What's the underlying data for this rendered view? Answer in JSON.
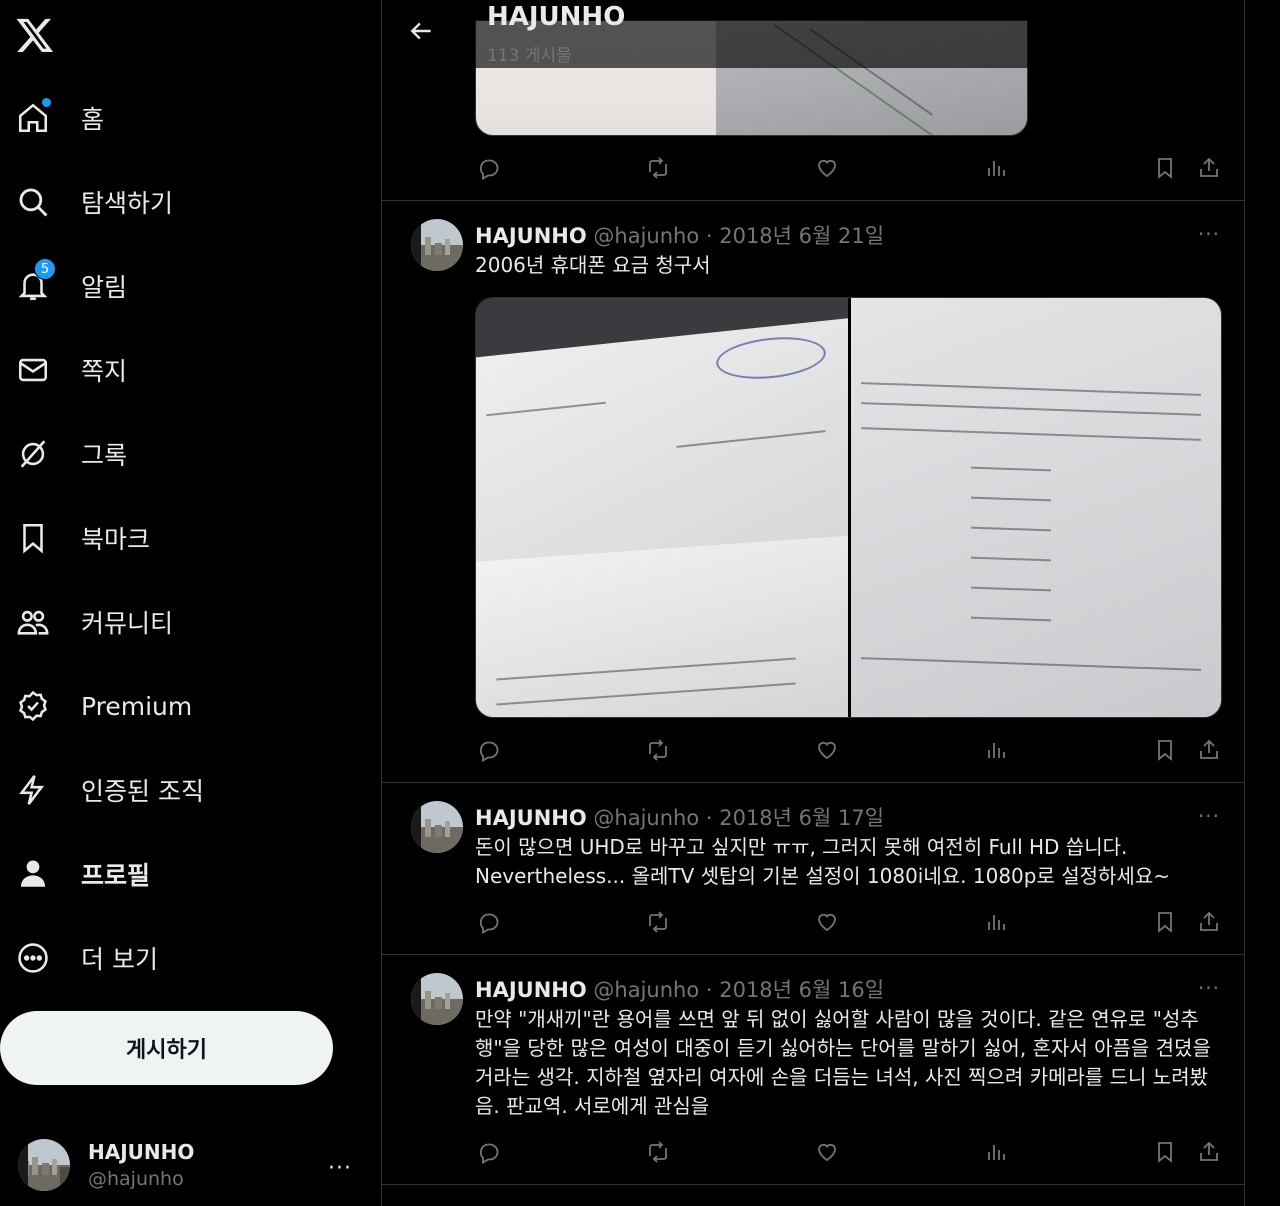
{
  "sidebar": {
    "items": [
      {
        "label": "홈",
        "icon": "home-icon"
      },
      {
        "label": "탐색하기",
        "icon": "search-icon"
      },
      {
        "label": "알림",
        "icon": "bell-icon"
      },
      {
        "label": "쪽지",
        "icon": "envelope-icon"
      },
      {
        "label": "그록",
        "icon": "grok-icon"
      },
      {
        "label": "북마크",
        "icon": "bookmark-icon"
      },
      {
        "label": "커뮤니티",
        "icon": "people-icon"
      },
      {
        "label": "Premium",
        "icon": "verified-badge-icon"
      },
      {
        "label": "인증된 조직",
        "icon": "lightning-icon"
      },
      {
        "label": "프로필",
        "icon": "person-icon"
      },
      {
        "label": "더 보기",
        "icon": "more-circle-icon"
      }
    ],
    "notification_count": "5",
    "post_button": "게시하기",
    "account": {
      "name": "HAJUNHO",
      "handle": "@hajunho",
      "more": "···"
    }
  },
  "header": {
    "title": "HAJUNHO",
    "subtitle": "113 게시물"
  },
  "tweets": [
    {
      "name": "HAJUNHO",
      "handle": "@hajunho",
      "date": "· 2018년 6월 21일",
      "text": "2006년 휴대폰 요금 청구서",
      "more": "···"
    },
    {
      "name": "HAJUNHO",
      "handle": "@hajunho",
      "date": "· 2018년 6월 17일",
      "text": "돈이 많으면 UHD로 바꾸고 싶지만 ㅠㅠ, 그러지 못해 여전히 Full HD 씁니다. Nevertheless...  올레TV 셋탑의 기본 설정이 1080i네요. 1080p로 설정하세요~",
      "more": "···"
    },
    {
      "name": "HAJUNHO",
      "handle": "@hajunho",
      "date": "· 2018년 6월 16일",
      "text": "만약 \"개새끼\"란 용어를 쓰면 앞 뒤 없이 싫어할 사람이 많을 것이다. 같은 연유로 \"성추행\"을 당한 많은 여성이 대중이 듣기 싫어하는 단어를 말하기 싫어, 혼자서 아픔을 견뎠을 거라는 생각. 지하철 옆자리 여자에 손을 더듬는 녀석, 사진 찍으려 카메라를 드니 노려봤음. 판교역. 서로에게 관심을",
      "more": "···"
    }
  ],
  "colors": {
    "accent": "#1d9bf0",
    "background": "#000000",
    "text": "#e7e9ea",
    "muted": "#71767b",
    "border": "#2f3336"
  }
}
